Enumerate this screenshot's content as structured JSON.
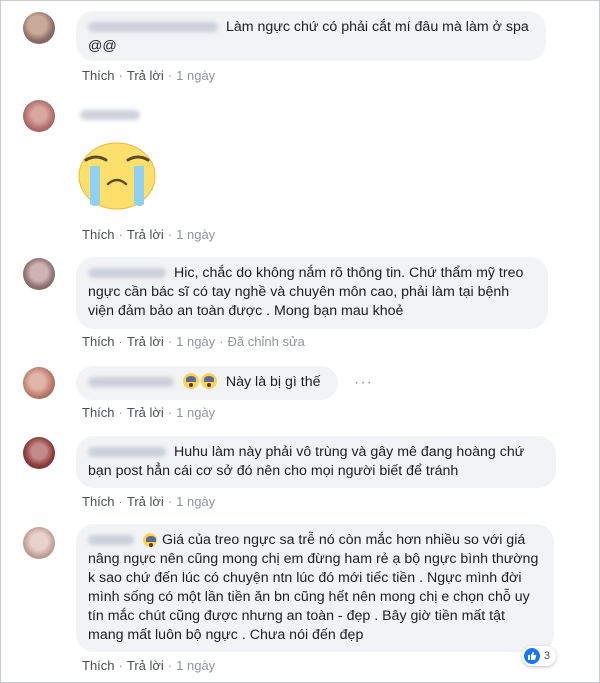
{
  "comments": [
    {
      "text": "Làm ngực chứ có phải cắt mí đâu mà làm ở spa @@",
      "actions": {
        "like": "Thích",
        "reply": "Trả lời",
        "time": "1 ngày"
      }
    },
    {
      "text": "",
      "sticker": "crying-face-sticker",
      "actions": {
        "like": "Thích",
        "reply": "Trả lời",
        "time": "1 ngày"
      }
    },
    {
      "text": "Hic, chắc do không nắm rõ thông tin. Chứ thẩm mỹ treo ngực cần bác sĩ có tay nghề và chuyên môn cao, phải làm tại bệnh viện đảm bảo an toàn được . Mong bạn mau khoẻ",
      "actions": {
        "like": "Thích",
        "reply": "Trả lời",
        "time": "1 ngày",
        "edited": "Đã chỉnh sửa"
      }
    },
    {
      "text": "Này là bị gì thế",
      "emoji": "screaming-face-icon",
      "actions": {
        "like": "Thích",
        "reply": "Trả lời",
        "time": "1 ngày"
      }
    },
    {
      "text": "Huhu làm này phải vô trùng và gây mê đang hoàng chứ bạn post hẳn cái cơ sở đó nên cho mọi người biết để tránh",
      "actions": {
        "like": "Thích",
        "reply": "Trả lời",
        "time": "1 ngày"
      }
    },
    {
      "text": "Giá của treo ngực sa trễ nó còn mắc hơn nhiều so với giá nâng ngực nên cũng mong chị em đừng ham rẻ ạ bộ ngực bình thường k sao chứ đến lúc có chuyện ntn lúc đó mới tiếc tiền . Ngực mình đời mình sống có một lần tiền ăn bn cũng hết nên mong chị e chọn chỗ uy tín mắc chút cũng được nhưng an toàn - đẹp . Bây giờ tiền mất tật mang mất luôn bộ ngực . Chưa nói đến đẹp",
      "actions": {
        "like": "Thích",
        "reply": "Trả lời",
        "time": "1 ngày"
      },
      "reaction_count": "3"
    }
  ],
  "colors": {
    "bubble": "#f2f3f5",
    "meta": "#4b4f56",
    "like_blue": "#1877f2"
  }
}
